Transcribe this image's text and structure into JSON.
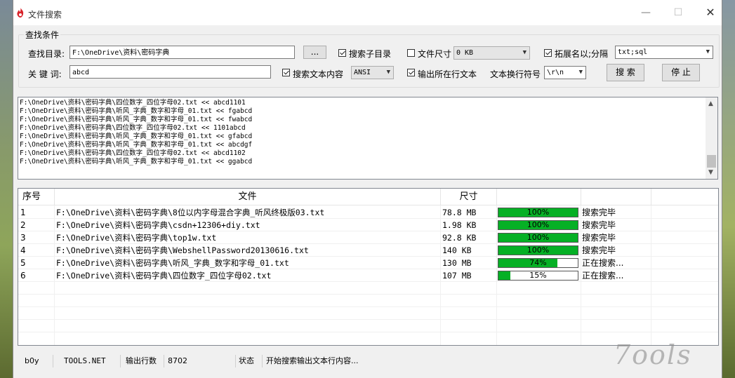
{
  "window": {
    "title": "文件搜索"
  },
  "search_conditions": {
    "group_title": "查找条件",
    "dir_label": "查找目录:",
    "dir_value": "F:\\OneDrive\\资料\\密码字典",
    "browse_label": "...",
    "subdir_label": "搜索子目录",
    "subdir_checked": true,
    "filesize_label": "文件尺寸",
    "filesize_checked": false,
    "filesize_value": "0 KB",
    "ext_label": "拓展名以;分隔",
    "ext_checked": true,
    "ext_value": "txt;sql",
    "keyword_label": "关 键 词:",
    "keyword_value": "abcd",
    "search_content_label": "搜索文本内容",
    "search_content_checked": true,
    "encoding_value": "ANSI",
    "output_line_label": "输出所在行文本",
    "output_line_checked": true,
    "newline_label": "文本换行符号",
    "newline_value": "\\r\\n",
    "search_button": "搜 索",
    "stop_button": "停 止"
  },
  "log_lines": [
    "F:\\OneDrive\\资料\\密码字典\\四位数字_四位字母02.txt << abcd1101",
    "F:\\OneDrive\\资料\\密码字典\\听风_字典_数字和字母_01.txt << fgabcd",
    "F:\\OneDrive\\资料\\密码字典\\听风_字典_数字和字母_01.txt << fwabcd",
    "F:\\OneDrive\\资料\\密码字典\\四位数字_四位字母02.txt << 1101abcd",
    "F:\\OneDrive\\资料\\密码字典\\听风_字典_数字和字母_01.txt << gfabcd",
    "F:\\OneDrive\\资料\\密码字典\\听风_字典_数字和字母_01.txt << abcdgf",
    "F:\\OneDrive\\资料\\密码字典\\四位数字_四位字母02.txt << abcd1102",
    "F:\\OneDrive\\资料\\密码字典\\听风_字典_数字和字母_01.txt << ggabcd"
  ],
  "table": {
    "headers": {
      "index": "序号",
      "file": "文件",
      "size": "尺寸"
    },
    "rows": [
      {
        "index": "1",
        "file": "F:\\OneDrive\\资料\\密码字典\\8位以内字母混合字典_听风终极版03.txt",
        "size": "78.8 MB",
        "progress": 100,
        "progress_text": "100%",
        "status": "搜索完毕"
      },
      {
        "index": "2",
        "file": "F:\\OneDrive\\资料\\密码字典\\csdn+12306+diy.txt",
        "size": "1.98 KB",
        "progress": 100,
        "progress_text": "100%",
        "status": "搜索完毕"
      },
      {
        "index": "3",
        "file": "F:\\OneDrive\\资料\\密码字典\\top1w.txt",
        "size": "92.8 KB",
        "progress": 100,
        "progress_text": "100%",
        "status": "搜索完毕"
      },
      {
        "index": "4",
        "file": "F:\\OneDrive\\资料\\密码字典\\WebshellPassword20130616.txt",
        "size": "140 KB",
        "progress": 100,
        "progress_text": "100%",
        "status": "搜索完毕"
      },
      {
        "index": "5",
        "file": "F:\\OneDrive\\资料\\密码字典\\听风_字典_数字和字母_01.txt",
        "size": "130 MB",
        "progress": 74,
        "progress_text": "74%",
        "status": "正在搜索..."
      },
      {
        "index": "6",
        "file": "F:\\OneDrive\\资料\\密码字典\\四位数字_四位字母02.txt",
        "size": "107 MB",
        "progress": 15,
        "progress_text": "15%",
        "status": "正在搜索..."
      }
    ]
  },
  "statusbar": {
    "author": "b0y",
    "site": "TOOLS.NET",
    "lines_label": "输出行数",
    "lines_value": "8702",
    "state_label": "状态",
    "state_value": "开始搜索输出文本行内容..."
  },
  "watermark": "7ools",
  "colors": {
    "progress_fill": "#06b025"
  }
}
